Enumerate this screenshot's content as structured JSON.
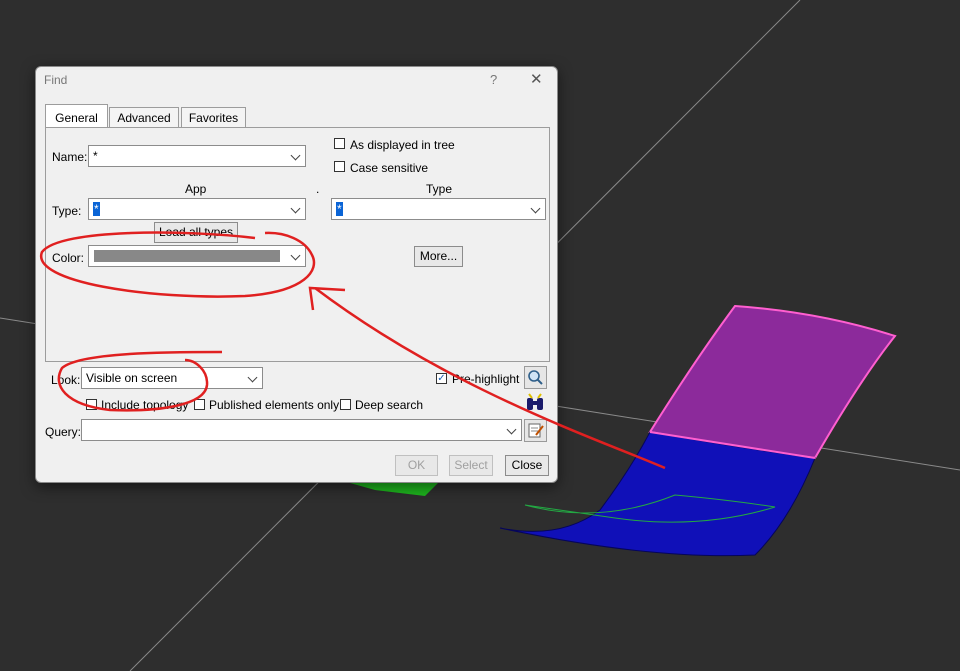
{
  "dialog": {
    "title": "Find",
    "help_label": "?",
    "close_label": "✕",
    "tabs": [
      "General",
      "Advanced",
      "Favorites"
    ]
  },
  "general": {
    "name_label": "Name:",
    "name_value": "*",
    "as_displayed_in_tree": "As displayed in tree",
    "case_sensitive": "Case sensitive",
    "app_header": "App",
    "separator": ".",
    "type_header": "Type",
    "type_label": "Type:",
    "app_value": "*",
    "type_value": "*",
    "load_all_types": "Load all types",
    "color_label": "Color:",
    "more_button": "More..."
  },
  "look": {
    "look_label": "Look:",
    "look_value": "Visible on screen",
    "pre_highlight": "Pre-highlight",
    "pre_highlight_checked": true,
    "include_topology": "Include topology",
    "include_topology_checked": false,
    "published_only": "Published elements only",
    "published_only_checked": false,
    "deep_search": "Deep search",
    "deep_search_checked": false,
    "query_label": "Query:",
    "query_value": ""
  },
  "actions": {
    "ok": "OK",
    "select": "Select",
    "close": "Close"
  },
  "colors": {
    "background": "#2e2e2e",
    "surface_top": "#8c2a9b",
    "surface_bottom": "#1010b8",
    "highlight_edge": "#ff5fd0",
    "annotation": "#e02020",
    "green_object": "#1db31d",
    "color_swatch": "#888888"
  }
}
